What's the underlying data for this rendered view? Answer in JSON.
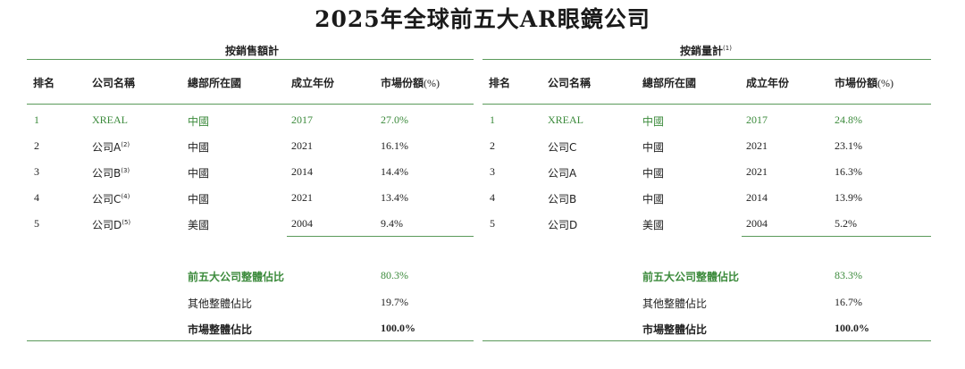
{
  "title": "2025年全球前五大AR眼鏡公司",
  "accent_color": "#3b8a3b",
  "columns": [
    "排名",
    "公司名稱",
    "總部所在國",
    "成立年份",
    "市場份額"
  ],
  "share_unit": "(%)",
  "left": {
    "group_title": "按銷售額計",
    "rows": [
      {
        "rank": "1",
        "company": "XREAL",
        "note": "",
        "country": "中國",
        "year": "2017",
        "share": "27.0%"
      },
      {
        "rank": "2",
        "company": "公司A",
        "note": "(2)",
        "country": "中國",
        "year": "2021",
        "share": "16.1%"
      },
      {
        "rank": "3",
        "company": "公司B",
        "note": "(3)",
        "country": "中國",
        "year": "2014",
        "share": "14.4%"
      },
      {
        "rank": "4",
        "company": "公司C",
        "note": "(4)",
        "country": "中國",
        "year": "2021",
        "share": "13.4%"
      },
      {
        "rank": "5",
        "company": "公司D",
        "note": "(5)",
        "country": "美國",
        "year": "2004",
        "share": "9.4%"
      }
    ],
    "summary": [
      {
        "label": "前五大公司整體佔比",
        "value": "80.3%"
      },
      {
        "label": "其他整體佔比",
        "value": "19.7%"
      },
      {
        "label": "市場整體佔比",
        "value": "100.0%"
      }
    ]
  },
  "right": {
    "group_title": "按銷量計",
    "group_note": "(1)",
    "rows": [
      {
        "rank": "1",
        "company": "XREAL",
        "country": "中國",
        "year": "2017",
        "share": "24.8%"
      },
      {
        "rank": "2",
        "company": "公司C",
        "country": "中國",
        "year": "2021",
        "share": "23.1%"
      },
      {
        "rank": "3",
        "company": "公司A",
        "country": "中國",
        "year": "2021",
        "share": "16.3%"
      },
      {
        "rank": "4",
        "company": "公司B",
        "country": "中國",
        "year": "2014",
        "share": "13.9%"
      },
      {
        "rank": "5",
        "company": "公司D",
        "country": "美國",
        "year": "2004",
        "share": "5.2%"
      }
    ],
    "summary": [
      {
        "label": "前五大公司整體佔比",
        "value": "83.3%"
      },
      {
        "label": "其他整體佔比",
        "value": "16.7%"
      },
      {
        "label": "市場整體佔比",
        "value": "100.0%"
      }
    ]
  }
}
